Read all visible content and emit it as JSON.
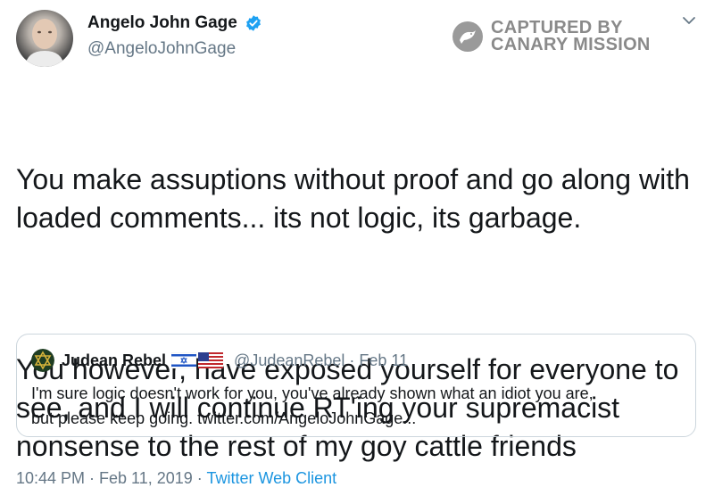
{
  "author": {
    "display_name": "Angelo John Gage",
    "handle": "@AngeloJohnGage",
    "verified": true
  },
  "watermark": {
    "line1": "CAPTURED BY",
    "line2": "CANARY MISSION"
  },
  "tweet": {
    "paragraph1": "You make assuptions without proof and go along with\nloaded comments... its not logic, its garbage.",
    "paragraph2": "You however, have exposed yourself for everyone to\nsee, and I will continue RT'ing your supremacist\nnonsense to the rest of my goy cattle friends"
  },
  "quoted_tweet": {
    "display_name": "Judean Rebel",
    "handle_and_date": "@JudeanRebel · Feb 11",
    "flags": [
      "israel-flag",
      "usa-flag"
    ],
    "text": "I'm sure logic doesn't work for you, you've already shown what an idiot you are,\nbut please keep going. twitter.com/AngeloJohnGage..."
  },
  "meta": {
    "timestamp": "10:44 PM · Feb 11, 2019 · ",
    "source": "Twitter Web Client"
  },
  "icons": [
    "verified-badge-icon",
    "canary-mission-logo",
    "chevron-down-icon",
    "israel-flag-icon",
    "usa-flag-icon"
  ],
  "colors": {
    "text": "#14171a",
    "secondary": "#657786",
    "link": "#1b95e0",
    "verified": "#1da1f2",
    "border": "#ccd6dd"
  }
}
